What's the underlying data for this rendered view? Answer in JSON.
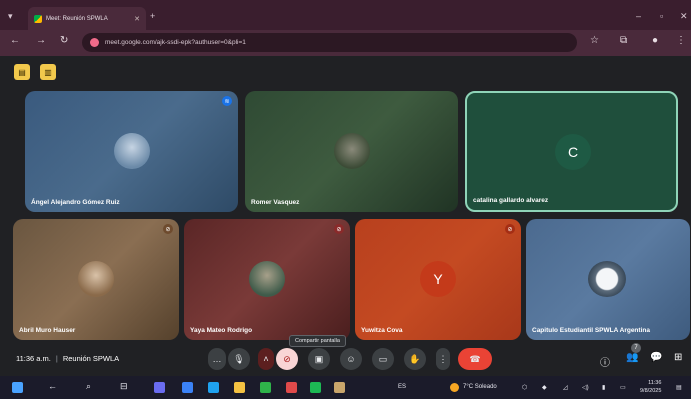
{
  "browser": {
    "tab_title": "Meet: Reunión SPWLA",
    "url": "meet.google.com/ajk-ssdi-epk?authuser=0&pli=1"
  },
  "participants": [
    {
      "name": "Ángel Alejandro Gómez Ruiz",
      "kind": "photo"
    },
    {
      "name": "Romer Vasquez",
      "kind": "photo"
    },
    {
      "name": "catalina gallardo alvarez",
      "kind": "letter",
      "letter": "C"
    },
    {
      "name": "Abril Muro Hauser",
      "kind": "photo"
    },
    {
      "name": "Yaya Mateo Rodrigo",
      "kind": "photo"
    },
    {
      "name": "Yuwitza Cova",
      "kind": "letter",
      "letter": "Y"
    },
    {
      "name": "Capitulo Estudiantil SPWLA Argentina",
      "kind": "photo"
    }
  ],
  "meeting": {
    "time": "11:36 a.m.",
    "name": "Reunión SPWLA",
    "tooltip": "Compartir pantalla",
    "participant_count": "7"
  },
  "taskbar": {
    "lang": "ES",
    "weather": "7°C  Soleado",
    "time": "11:36",
    "date": "9/8/2025"
  }
}
